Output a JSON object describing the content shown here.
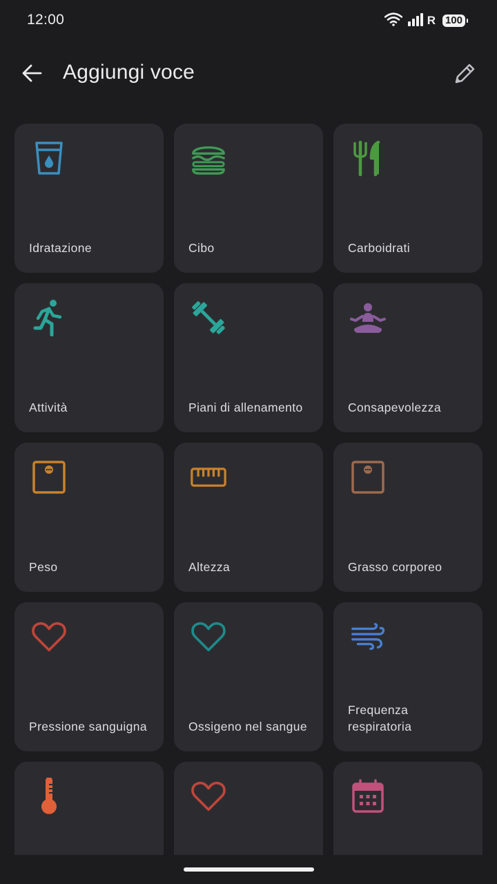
{
  "status_bar": {
    "time": "12:00",
    "network_label": "R",
    "battery": "100"
  },
  "app_bar": {
    "title": "Aggiungi voce",
    "back_icon": "arrow-back-icon",
    "edit_icon": "pencil-icon"
  },
  "tiles": [
    {
      "label": "Idratazione",
      "icon": "water-glass-icon",
      "color": "#3a8fc0"
    },
    {
      "label": "Cibo",
      "icon": "burger-icon",
      "color": "#3f9a54"
    },
    {
      "label": "Carboidrati",
      "icon": "fork-knife-icon",
      "color": "#4c9a40"
    },
    {
      "label": "Attività",
      "icon": "running-icon",
      "color": "#2aa69a"
    },
    {
      "label": "Piani di allenamento",
      "icon": "dumbbell-icon",
      "color": "#2aa69a"
    },
    {
      "label": "Consapevolezza",
      "icon": "meditation-icon",
      "color": "#8a5c9c"
    },
    {
      "label": "Peso",
      "icon": "scale-icon",
      "color": "#c9822c"
    },
    {
      "label": "Altezza",
      "icon": "ruler-icon",
      "color": "#c9822c"
    },
    {
      "label": "Grasso corporeo",
      "icon": "body-fat-scale-icon",
      "color": "#9c6a4e"
    },
    {
      "label": "Pressione sanguigna",
      "icon": "heart-outline-icon",
      "color": "#c0453a"
    },
    {
      "label": "Ossigeno nel sangue",
      "icon": "heart-outline-icon",
      "color": "#1f8a8a"
    },
    {
      "label": "Frequenza respiratoria",
      "icon": "wind-icon",
      "color": "#4a7fd0"
    },
    {
      "label": "",
      "icon": "thermometer-icon",
      "color": "#e0603a"
    },
    {
      "label": "",
      "icon": "heart-outline-icon",
      "color": "#c0453a"
    },
    {
      "label": "",
      "icon": "calendar-icon",
      "color": "#c0527a"
    }
  ]
}
